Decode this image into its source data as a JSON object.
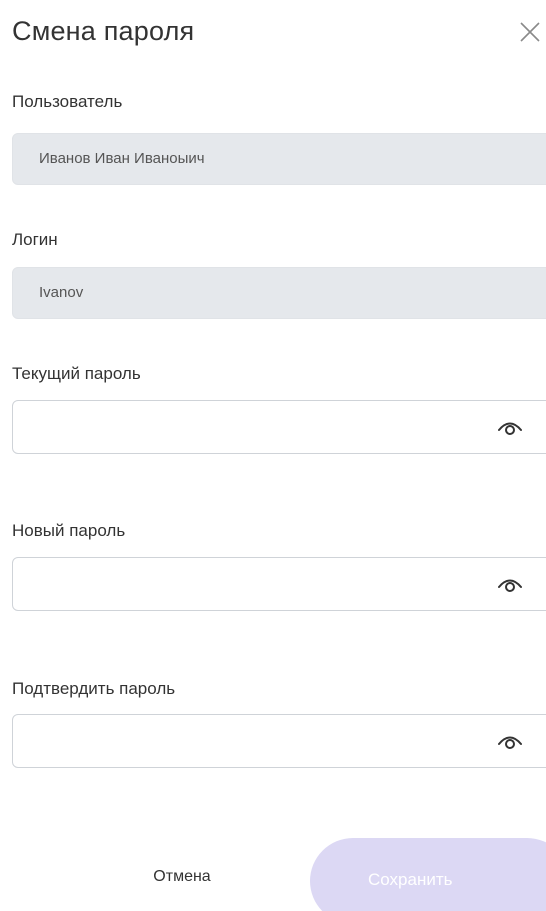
{
  "dialog": {
    "title": "Смена пароля",
    "close_icon": "close-icon"
  },
  "fields": {
    "user": {
      "label": "Пользователь",
      "value": "Иванов Иван Иваноыич"
    },
    "login": {
      "label": "Логин",
      "value": "Ivanov"
    },
    "current_password": {
      "label": "Текущий пароль",
      "value": "",
      "icon": "eye-icon"
    },
    "new_password": {
      "label": "Новый пароль",
      "value": "",
      "icon": "eye-icon"
    },
    "confirm_password": {
      "label": "Подтвердить пароль",
      "value": "",
      "icon": "eye-icon"
    }
  },
  "actions": {
    "cancel_label": "Отмена",
    "save_label": "Сохранить"
  },
  "colors": {
    "readonly_bg": "#e5e8ec",
    "save_bg": "#dcd8f4",
    "text": "#333333"
  }
}
